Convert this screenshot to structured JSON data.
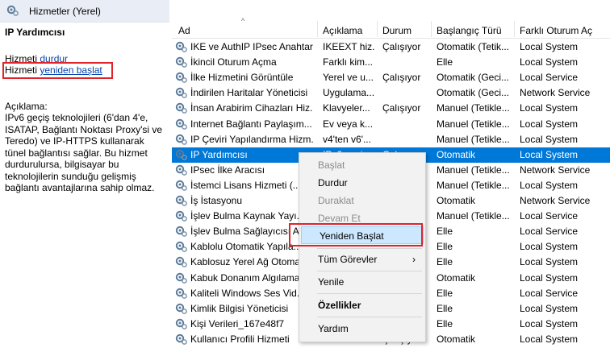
{
  "window": {
    "title": "Hizmetler (Yerel)"
  },
  "left_pane": {
    "heading": "IP Yardımcısı",
    "stop_prefix": "Hizmeti",
    "stop_link": "durdur",
    "restart_prefix": "Hizmeti",
    "restart_link": "yeniden başlat",
    "desc_label": "Açıklama:",
    "description": "IPv6 geçiş teknolojileri (6'dan 4'e, ISATAP, Bağlantı Noktası Proxy'si ve Teredo) ve IP-HTTPS kullanarak tünel bağlantısı sağlar. Bu hizmet durdurulursa, bilgisayar bu teknolojilerin sunduğu gelişmiş bağlantı avantajlarına sahip olmaz."
  },
  "columns": {
    "ad": "Ad",
    "aciklama": "Açıklama",
    "durum": "Durum",
    "baslangic": "Başlangıç Türü",
    "oturum": "Farklı Oturum Aç"
  },
  "services": [
    {
      "name": "IKE ve AuthIP IPsec Anahtar...",
      "desc": "IKEEXT hiz...",
      "state": "Çalışıyor",
      "start": "Otomatik (Tetik...",
      "logon": "Local System"
    },
    {
      "name": "İkincil Oturum Açma",
      "desc": "Farklı kim...",
      "state": "",
      "start": "Elle",
      "logon": "Local System"
    },
    {
      "name": "İlke Hizmetini Görüntüle",
      "desc": "Yerel ve u...",
      "state": "Çalışıyor",
      "start": "Otomatik (Geci...",
      "logon": "Local Service"
    },
    {
      "name": "İndirilen Haritalar Yöneticisi",
      "desc": "Uygulama...",
      "state": "",
      "start": "Otomatik (Geci...",
      "logon": "Network Service"
    },
    {
      "name": "İnsan Arabirim Cihazları Hiz...",
      "desc": "Klavyeler...",
      "state": "Çalışıyor",
      "start": "Manuel (Tetikle...",
      "logon": "Local System"
    },
    {
      "name": "Internet Bağlantı Paylaşım...",
      "desc": "Ev veya k...",
      "state": "",
      "start": "Manuel (Tetikle...",
      "logon": "Local System"
    },
    {
      "name": "IP Çeviri Yapılandırma Hizm...",
      "desc": "v4'ten v6'...",
      "state": "",
      "start": "Manuel (Tetikle...",
      "logon": "Local System"
    },
    {
      "name": "IP Yardımcısı",
      "desc": "IPv6 geçi...",
      "state": "Çalışıyor",
      "start": "Otomatik",
      "logon": "Local System"
    },
    {
      "name": "IPsec İlke Aracısı",
      "desc": "",
      "state": "",
      "start": "Manuel (Tetikle...",
      "logon": "Network Service"
    },
    {
      "name": "İstemci Lisans Hizmeti (...",
      "desc": "",
      "state": "",
      "start": "Manuel (Tetikle...",
      "logon": "Local System"
    },
    {
      "name": "İş İstasyonu",
      "desc": "",
      "state": "",
      "start": "Otomatik",
      "logon": "Network Service"
    },
    {
      "name": "İşlev Bulma Kaynak Yayı...",
      "desc": "",
      "state": "",
      "start": "Manuel (Tetikle...",
      "logon": "Local Service"
    },
    {
      "name": "İşlev Bulma Sağlayıcısı A...",
      "desc": "",
      "state": "",
      "start": "Elle",
      "logon": "Local Service"
    },
    {
      "name": "Kablolu Otomatik Yapıla...",
      "desc": "",
      "state": "",
      "start": "Elle",
      "logon": "Local System"
    },
    {
      "name": "Kablosuz Yerel Ağ Otoma...",
      "desc": "",
      "state": "",
      "start": "Elle",
      "logon": "Local System"
    },
    {
      "name": "Kabuk Donanım Algılama...",
      "desc": "",
      "state": "",
      "start": "Otomatik",
      "logon": "Local System"
    },
    {
      "name": "Kaliteli Windows Ses Vid...",
      "desc": "",
      "state": "",
      "start": "Elle",
      "logon": "Local Service"
    },
    {
      "name": "Kimlik Bilgisi Yöneticisi",
      "desc": "",
      "state": "",
      "start": "Elle",
      "logon": "Local System"
    },
    {
      "name": "Kişi Verileri_167e48f7",
      "desc": "",
      "state": "",
      "start": "Elle",
      "logon": "Local System"
    },
    {
      "name": "Kullanıcı Profili Hizmeti",
      "desc": "",
      "state": "Çalışıyor",
      "start": "Otomatik",
      "logon": "Local System"
    }
  ],
  "context_menu": {
    "start": "Başlat",
    "stop": "Durdur",
    "pause": "Duraklat",
    "resume": "Devam Et",
    "restart": "Yeniden Başlat",
    "all_tasks": "Tüm Görevler",
    "refresh": "Yenile",
    "properties": "Özellikler",
    "help": "Yardım"
  },
  "colors": {
    "selection": "#0078d7",
    "highlight_box": "#e0222b",
    "menu_hover": "#cce8ff",
    "link": "#0645ad"
  }
}
